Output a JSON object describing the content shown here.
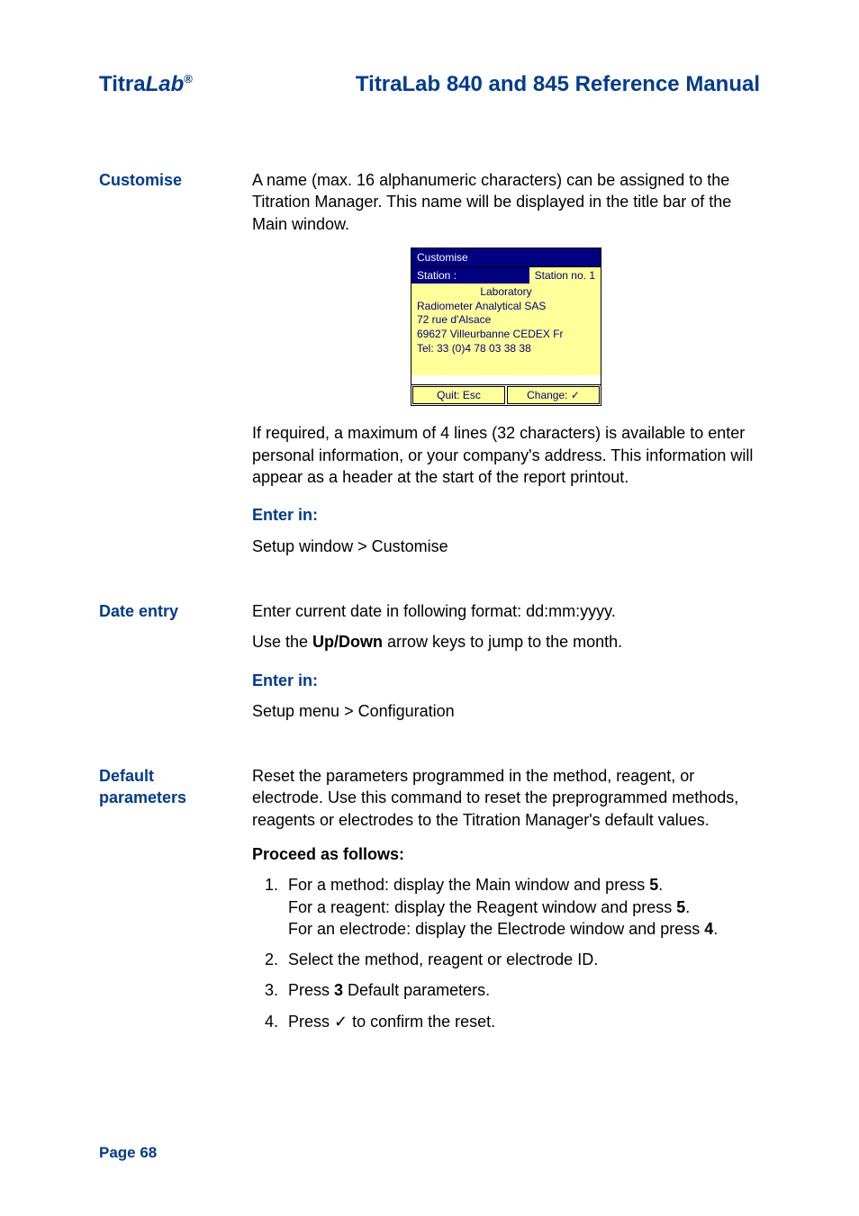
{
  "header": {
    "brand_titra": "Titra",
    "brand_lab": "Lab",
    "manual_title": "TitraLab 840 and 845 Reference Manual"
  },
  "sections": {
    "customise": {
      "label": "Customise",
      "para1": "A name (max. 16 alphanumeric characters) can be assigned to the Titration Manager. This name will be displayed in the title bar of the Main window.",
      "para2": "If required, a maximum of 4 lines (32 characters) is available to enter personal information, or your company's address. This information will appear as a header at the start of the report printout.",
      "enter_in_label": "Enter in:",
      "enter_in_path": "Setup window > Customise"
    },
    "device": {
      "title": "Customise",
      "station_label": "Station :",
      "station_value": "Station no. 1",
      "line_center": "Laboratory",
      "line1": "Radiometer Analytical SAS",
      "line2": "72 rue d'Alsace",
      "line3": "69627 Villeurbanne CEDEX Fr",
      "line4": "Tel: 33 (0)4 78 03 38 38",
      "quit": "Quit: Esc",
      "change": "Change: ✓"
    },
    "date_entry": {
      "label": "Date entry",
      "para1": "Enter current date in following format: dd:mm:yyyy.",
      "para2_pre": "Use the ",
      "para2_bold": "Up/Down",
      "para2_post": " arrow keys to jump to the month.",
      "enter_in_label": "Enter in:",
      "enter_in_path": "Setup menu > Configuration"
    },
    "default_params": {
      "label_line1": "Default",
      "label_line2": "parameters",
      "para1": "Reset the parameters programmed in the method, reagent, or electrode. Use this command to reset the preprogrammed methods, reagents or electrodes to the Titration Manager's default values.",
      "proceed_label": "Proceed as follows:",
      "step1_a": "For a method: display the Main window and press ",
      "step1_a_bold": "5",
      "step1_a_end": ".",
      "step1_b": "For a reagent: display the Reagent window and press ",
      "step1_b_bold": "5",
      "step1_b_end": ".",
      "step1_c": "For an electrode: display the Electrode window and press ",
      "step1_c_bold": "4",
      "step1_c_end": ".",
      "step2": "Select the method, reagent or electrode ID.",
      "step3_pre": "Press ",
      "step3_bold": "3",
      "step3_post": " Default parameters.",
      "step4_pre": "Press ",
      "step4_sym": "✓",
      "step4_post": " to confirm the reset."
    }
  },
  "footer": {
    "page_label": "Page 68"
  }
}
